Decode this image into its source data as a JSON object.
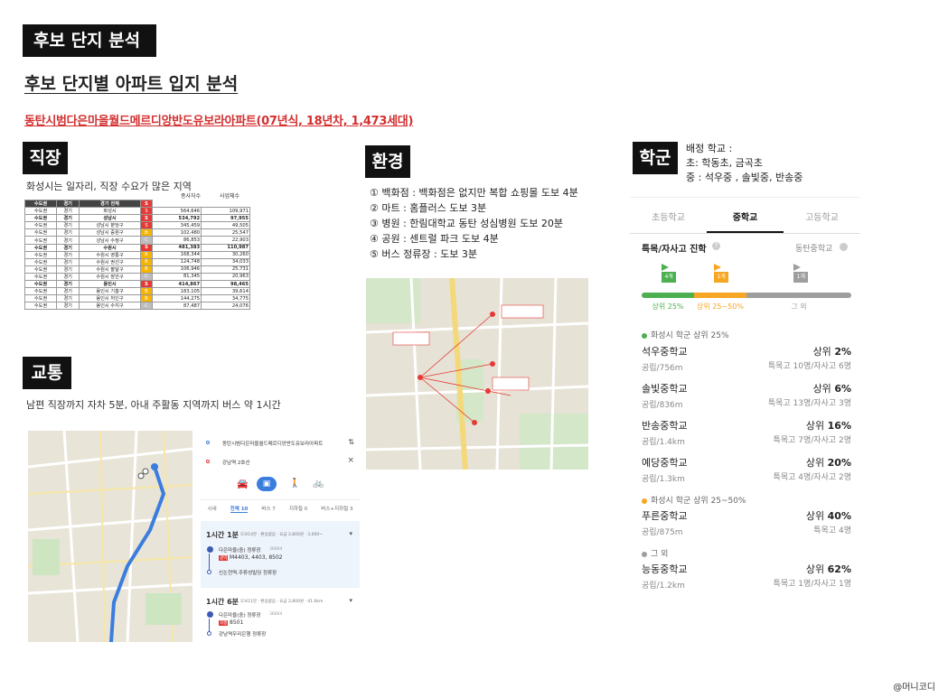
{
  "header": {
    "main_tag": "후보 단지 분석",
    "subtitle": "후보 단지별 아파트 입지 분석",
    "apt_line": "동탄시범다은마을월드메르디앙반도유보라아파트(07년식, 18년차, 1,473세대)"
  },
  "jobs": {
    "tag": "직장",
    "caption": "화성시는 일자리, 직장 수요가 많은 지역",
    "top_headers": [
      "종사자수",
      "사업체수"
    ],
    "col_headers": [
      "수도권",
      "경기",
      "경기 전체",
      "S"
    ],
    "rows": [
      {
        "a": "수도권",
        "b": "경기",
        "c": "화성시",
        "g": "S",
        "g_color": "#e53935",
        "e": "564,646",
        "f": "109,971",
        "bold": false
      },
      {
        "a": "수도권",
        "b": "경기",
        "c": "성남시",
        "g": "S",
        "g_color": "#e53935",
        "e": "534,792",
        "f": "97,955",
        "bold": true
      },
      {
        "a": "수도권",
        "b": "경기",
        "c": "성남시 분당구",
        "g": "S",
        "g_color": "#e53935",
        "e": "345,459",
        "f": "49,505",
        "bold": false
      },
      {
        "a": "수도권",
        "b": "경기",
        "c": "성남시 중원구",
        "g": "B",
        "g_color": "#f6b400",
        "e": "102,480",
        "f": "25,547",
        "bold": false
      },
      {
        "a": "수도권",
        "b": "경기",
        "c": "성남시 수정구",
        "g": "C",
        "g_color": "#bdbdbd",
        "e": "86,853",
        "f": "22,903",
        "bold": false
      },
      {
        "a": "수도권",
        "b": "경기",
        "c": "수원시",
        "g": "S",
        "g_color": "#e53935",
        "e": "481,383",
        "f": "110,987",
        "bold": true
      },
      {
        "a": "수도권",
        "b": "경기",
        "c": "수원시 영통구",
        "g": "B",
        "g_color": "#f6b400",
        "e": "168,344",
        "f": "30,260",
        "bold": false
      },
      {
        "a": "수도권",
        "b": "경기",
        "c": "수원시 권선구",
        "g": "B",
        "g_color": "#f6b400",
        "e": "124,748",
        "f": "34,033",
        "bold": false
      },
      {
        "a": "수도권",
        "b": "경기",
        "c": "수원시 팔달구",
        "g": "B",
        "g_color": "#f6b400",
        "e": "106,946",
        "f": "25,731",
        "bold": false
      },
      {
        "a": "수도권",
        "b": "경기",
        "c": "수원시 장안구",
        "g": "C",
        "g_color": "#bdbdbd",
        "e": "81,345",
        "f": "20,963",
        "bold": false
      },
      {
        "a": "수도권",
        "b": "경기",
        "c": "용인시",
        "g": "S",
        "g_color": "#e53935",
        "e": "414,867",
        "f": "98,465",
        "bold": true
      },
      {
        "a": "수도권",
        "b": "경기",
        "c": "용인시 기흥구",
        "g": "B",
        "g_color": "#f6b400",
        "e": "183,105",
        "f": "39,614",
        "bold": false
      },
      {
        "a": "수도권",
        "b": "경기",
        "c": "용인시 처인구",
        "g": "B",
        "g_color": "#f6b400",
        "e": "144,275",
        "f": "34,775",
        "bold": false
      },
      {
        "a": "수도권",
        "b": "경기",
        "c": "용인시 수지구",
        "g": "C",
        "g_color": "#bdbdbd",
        "e": "87,487",
        "f": "24,076",
        "bold": false
      }
    ]
  },
  "transport": {
    "tag": "교통",
    "caption": "남편 직장까지 자차 5분, 아내 주활동 지역까지 버스 약 1시간",
    "origin": "동탄시범다은마을월드메르디앙반도유보라아파트",
    "destination": "강남역 2호선",
    "mode_icons": [
      "car-icon",
      "bus-icon",
      "walk-icon",
      "bike-icon"
    ],
    "filters": [
      "시내",
      "전체 10",
      "버스 7",
      "지하철 0",
      "버스+지하철 3"
    ],
    "route1": {
      "time": "1시간 1분",
      "meta": "도보14분 · 환승없음 · 요금 2,800원 · 3,000~",
      "stop": "다은마을(중) 정류장",
      "stop_id": "36664",
      "buses": "M4403, 4403, 8502",
      "bus_tag": "광역",
      "bus_tag2": "직행",
      "end": "신논현역.주류성빌딩 정류장"
    },
    "route2": {
      "time": "1시간 6분",
      "meta": "도보11분 · 환승없음 · 요금 2,800원 · 41.6km",
      "stop": "다은마을(중) 정류장",
      "stop_id": "36664",
      "buses": "8501",
      "bus_tag": "직행",
      "end": "강남역우리은행 정류장"
    }
  },
  "environment": {
    "tag": "환경",
    "items": [
      "① 백화점 : 백화점은 없지만 복합 쇼핑몰 도보 4분",
      "② 마트 : 홈플러스 도보 3분",
      "③ 병원 : 한림대학교 동탄 성심병원 도보 20분",
      "④ 공원 : 센트럴 파크 도보 4분",
      "⑤ 버스 정류장 : 도보 3분"
    ]
  },
  "school": {
    "tag": "학군",
    "info": [
      "배정 학교 :",
      "초: 학동초, 금곡초",
      "중 : 석우중 , 솔빛중, 반송중"
    ],
    "tabs": [
      "초등학교",
      "중학교",
      "고등학교"
    ],
    "active_tab": 1,
    "adv_title": "특목/자사고 진학",
    "adv_right": "동탄중학교",
    "flags": [
      {
        "label": "4개",
        "color": "#4caf50",
        "pos": 0.13
      },
      {
        "label": "1개",
        "color": "#f6a623",
        "pos": 0.38
      },
      {
        "label": "1개",
        "color": "#9e9e9e",
        "pos": 0.76
      }
    ],
    "bar": [
      {
        "color": "#4caf50",
        "share": 0.25,
        "label": "상위 25%"
      },
      {
        "color": "#f6a623",
        "share": 0.25,
        "label": "상위 25~50%"
      },
      {
        "color": "#9e9e9e",
        "share": 0.5,
        "label": "그 외"
      }
    ],
    "groups": [
      {
        "label": "화성시 학군 상위 25%",
        "color": "#4caf50"
      },
      {
        "label": "화성시 학군 상위 25~50%",
        "color": "#f6a623"
      },
      {
        "label": "그 외",
        "color": "#9e9e9e"
      }
    ],
    "schools": [
      {
        "name": "석우중학교",
        "rank_prefix": "상위 ",
        "rank": "2%",
        "dist": "공립/756m",
        "detail": "특목고 10명/자사고 6명"
      },
      {
        "name": "솔빛중학교",
        "rank_prefix": "상위 ",
        "rank": "6%",
        "dist": "공립/836m",
        "detail": "특목고 13명/자사고 3명"
      },
      {
        "name": "반송중학교",
        "rank_prefix": "상위 ",
        "rank": "16%",
        "dist": "공립/1.4km",
        "detail": "특목고 7명/자사고 2명"
      },
      {
        "name": "예당중학교",
        "rank_prefix": "상위 ",
        "rank": "20%",
        "dist": "공립/1.3km",
        "detail": "특목고 4명/자사고 2명"
      },
      {
        "name": "푸른중학교",
        "rank_prefix": "상위 ",
        "rank": "40%",
        "dist": "공립/875m",
        "detail": "특목고 4명"
      },
      {
        "name": "능동중학교",
        "rank_prefix": "상위 ",
        "rank": "62%",
        "dist": "공립/1.2km",
        "detail": "특목고 1명/자사고 1명"
      }
    ]
  },
  "footer": {
    "credit": "@머니코디"
  }
}
